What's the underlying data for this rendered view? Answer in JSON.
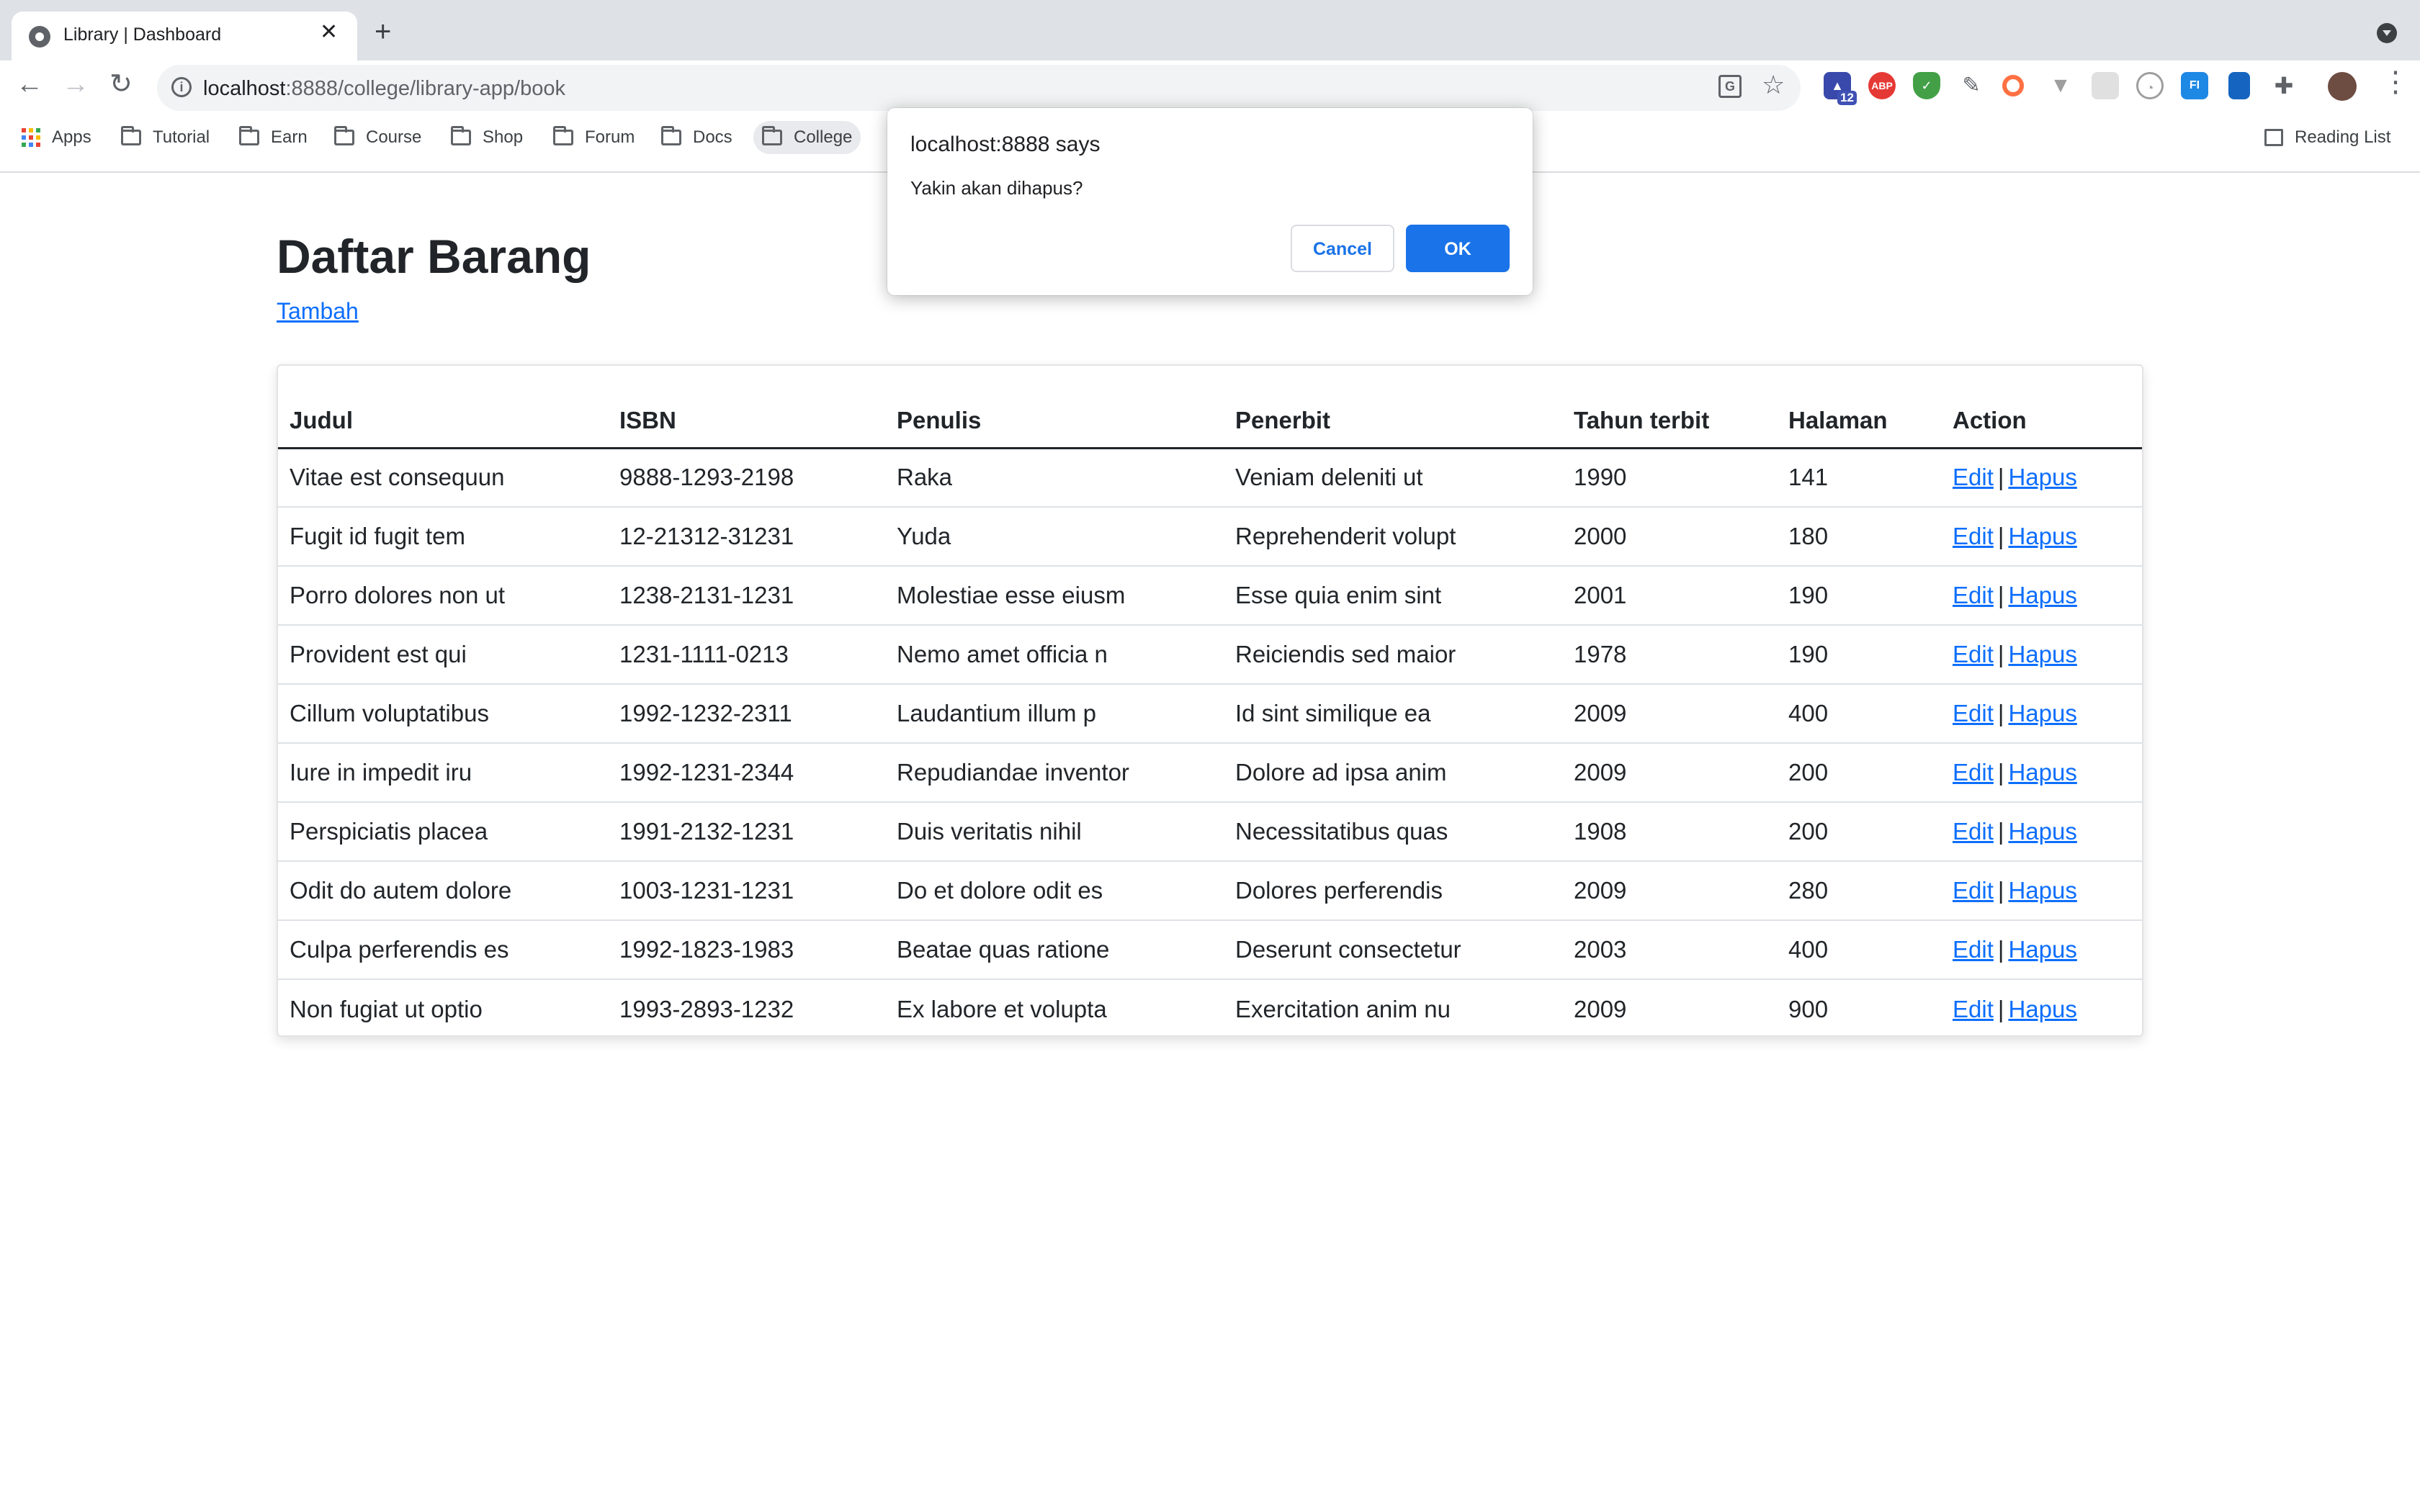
{
  "browser": {
    "tab_title": "Library | Dashboard",
    "url_host": "localhost",
    "url_path": ":8888/college/library-app/book",
    "extension_badge": "12",
    "bookmarks": [
      {
        "label": "Apps"
      },
      {
        "label": "Tutorial"
      },
      {
        "label": "Earn"
      },
      {
        "label": "Course"
      },
      {
        "label": "Shop"
      },
      {
        "label": "Forum"
      },
      {
        "label": "Docs"
      },
      {
        "label": "College"
      }
    ],
    "reading_list": "Reading List"
  },
  "page": {
    "title": "Daftar Barang",
    "add_link": "Tambah"
  },
  "table": {
    "headers": [
      "Judul",
      "ISBN",
      "Penulis",
      "Penerbit",
      "Tahun terbit",
      "Halaman",
      "Action"
    ],
    "action_edit": "Edit",
    "action_separator": "|",
    "action_delete": "Hapus",
    "rows": [
      [
        "Vitae est consequun",
        "9888-1293-2198",
        "Raka",
        "Veniam deleniti ut",
        "1990",
        "141"
      ],
      [
        "Fugit id fugit tem",
        "12-21312-31231",
        "Yuda",
        "Reprehenderit volupt",
        "2000",
        "180"
      ],
      [
        "Porro dolores non ut",
        "1238-2131-1231",
        "Molestiae esse eiusm",
        "Esse quia enim sint",
        "2001",
        "190"
      ],
      [
        "Provident est qui",
        "1231-1111-0213",
        "Nemo amet officia n",
        "Reiciendis sed maior",
        "1978",
        "190"
      ],
      [
        "Cillum voluptatibus",
        "1992-1232-2311",
        "Laudantium illum p",
        "Id sint similique ea",
        "2009",
        "400"
      ],
      [
        "Iure in impedit iru",
        "1992-1231-2344",
        "Repudiandae inventor",
        "Dolore ad ipsa anim",
        "2009",
        "200"
      ],
      [
        "Perspiciatis placea",
        "1991-2132-1231",
        "Duis veritatis nihil",
        "Necessitatibus quas",
        "1908",
        "200"
      ],
      [
        "Odit do autem dolore",
        "1003-1231-1231",
        "Do et dolore odit es",
        "Dolores perferendis",
        "2009",
        "280"
      ],
      [
        "Culpa perferendis es",
        "1992-1823-1983",
        "Beatae quas ratione",
        "Deserunt consectetur",
        "2003",
        "400"
      ],
      [
        "Non fugiat ut optio",
        "1993-2893-1232",
        "Ex labore et volupta",
        "Exercitation anim nu",
        "2009",
        "900"
      ]
    ]
  },
  "dialog": {
    "title": "localhost:8888 says",
    "message": "Yakin akan dihapus?",
    "cancel_label": "Cancel",
    "ok_label": "OK"
  },
  "colors": {
    "link": "#0d6efd",
    "dialog_primary": "#1a73e8",
    "chrome_bg": "#dee1e6"
  }
}
